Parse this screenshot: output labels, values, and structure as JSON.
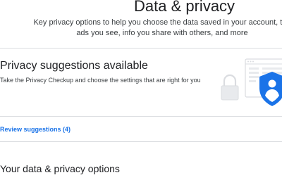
{
  "header": {
    "title": "Data & privacy",
    "subtitle": "Key privacy options to help you choose the data saved in your account, the ads you see, info you share with others, and more"
  },
  "privacy_card": {
    "title": "Privacy suggestions available",
    "description": "Take the Privacy Checkup and choose the settings that are right for you",
    "illustration": "privacy-checkup-shield-icon",
    "action_label": "Review suggestions (4)"
  },
  "section": {
    "title": "Your data & privacy options"
  },
  "colors": {
    "link": "#1a73e8",
    "shield": "#1a73e8",
    "divider": "#dadce0"
  }
}
